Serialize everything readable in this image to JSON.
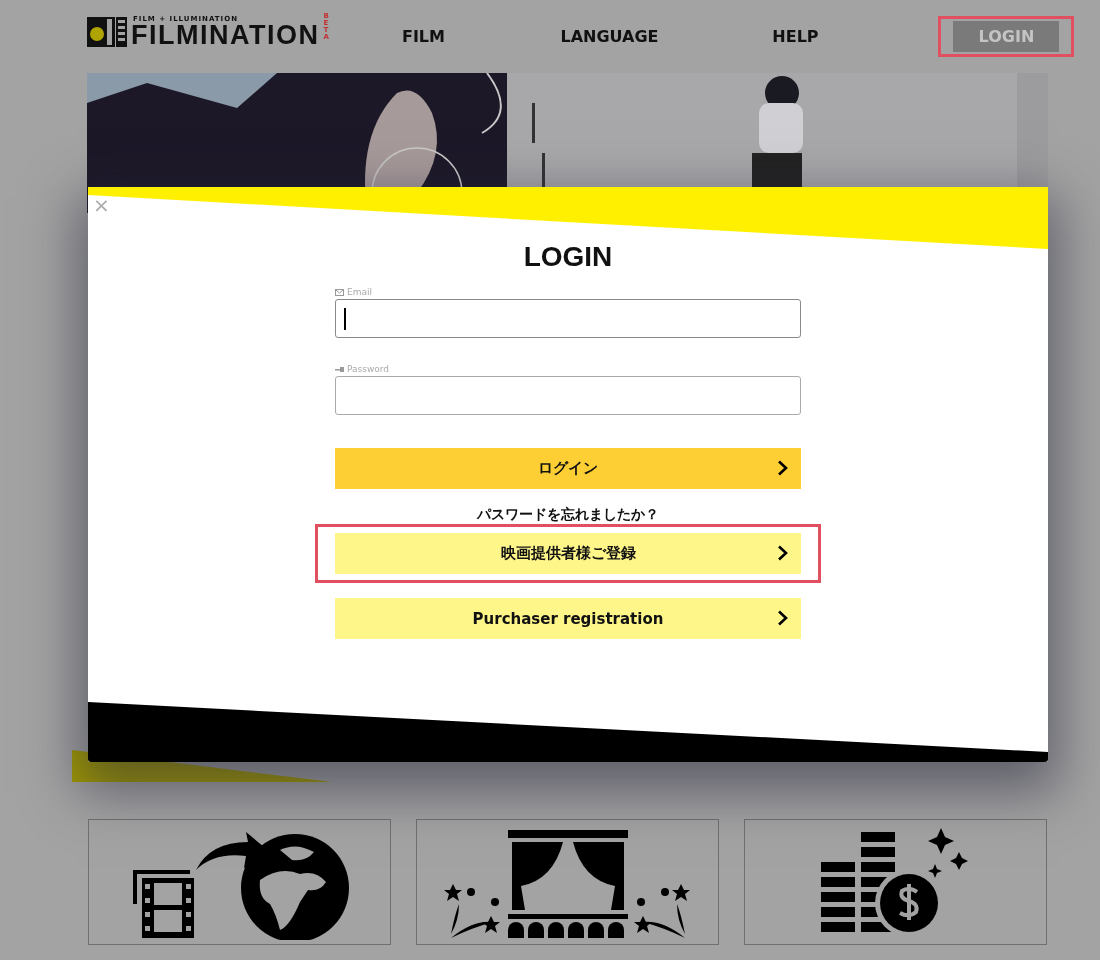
{
  "header": {
    "logo": {
      "tagline": "FILM + ILLUMINATION",
      "name": "FILMINATION",
      "badge": "BETA"
    },
    "nav": [
      {
        "label": "FILM",
        "kind": "link",
        "highlighted": false
      },
      {
        "label": "LANGUAGE",
        "kind": "link",
        "highlighted": false
      },
      {
        "label": "HELP",
        "kind": "link",
        "highlighted": false
      },
      {
        "label": "LOGIN",
        "kind": "button",
        "highlighted": true
      }
    ]
  },
  "modal": {
    "close": "×",
    "title": "LOGIN",
    "fields": [
      {
        "label": "Email",
        "kind": "email",
        "focused": true
      },
      {
        "label": "Password",
        "kind": "password",
        "focused": false
      }
    ],
    "login_button": {
      "label": "ログイン"
    },
    "forgot_link": "パスワードを忘れましたか？",
    "register_buttons": [
      {
        "label": "映画提供者様ご登録",
        "highlighted": true
      },
      {
        "label": "Purchaser registration",
        "highlighted": false
      }
    ]
  },
  "feature_cards": [
    {
      "kind": "distribution"
    },
    {
      "kind": "screening"
    },
    {
      "kind": "revenue"
    }
  ]
}
